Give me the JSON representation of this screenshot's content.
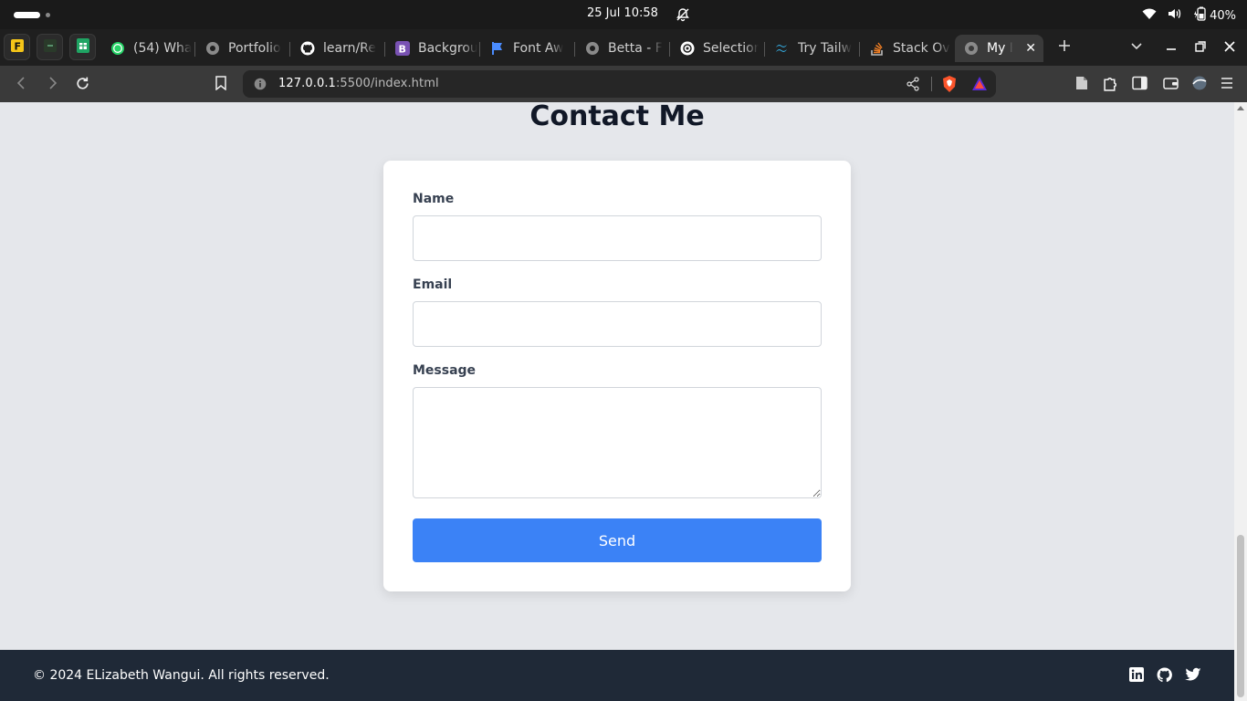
{
  "os": {
    "clock": "25 Jul  10:58",
    "battery": "40%"
  },
  "tabs": [
    {
      "label": "(54) Wha",
      "icon": "whatsapp-icon"
    },
    {
      "label": "Portfolio",
      "icon": "globe-icon"
    },
    {
      "label": "learn/Re",
      "icon": "github-icon"
    },
    {
      "label": "Backgrou",
      "icon": "bootstrap-icon"
    },
    {
      "label": "Font Aw",
      "icon": "flag-icon"
    },
    {
      "label": "Betta - F",
      "icon": "globe-icon"
    },
    {
      "label": "Selectior",
      "icon": "openai-icon"
    },
    {
      "label": "Try Tailw",
      "icon": "tailwind-icon"
    },
    {
      "label": "Stack Ov",
      "icon": "stackoverflow-icon"
    },
    {
      "label": "My P",
      "icon": "globe-icon",
      "active": true
    }
  ],
  "address": {
    "host": "127.0.0.1",
    "path": ":5500/index.html"
  },
  "page": {
    "title": "Contact Me",
    "form": {
      "name_label": "Name",
      "name_value": "",
      "email_label": "Email",
      "email_value": "",
      "message_label": "Message",
      "message_value": "",
      "send_label": "Send"
    },
    "footer": {
      "copyright": "© 2024 ELizabeth Wangui. All rights reserved.",
      "social": [
        "linkedin-icon",
        "github-icon",
        "twitter-icon"
      ]
    }
  },
  "colors": {
    "accent": "#3b82f6",
    "page_bg": "#e5e7eb",
    "footer_bg": "#1f2937"
  }
}
